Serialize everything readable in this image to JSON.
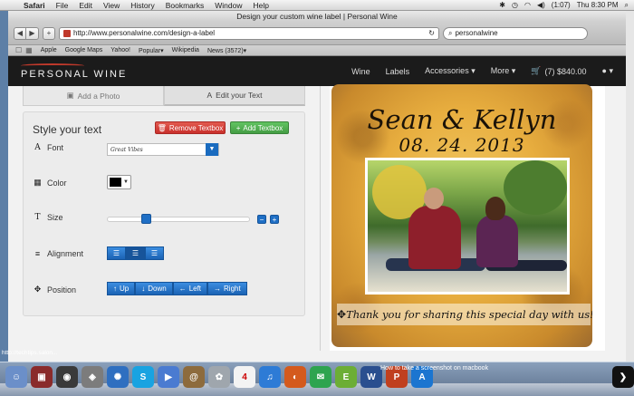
{
  "os_menu": {
    "app": "Safari",
    "items": [
      "File",
      "Edit",
      "View",
      "History",
      "Bookmarks",
      "Window",
      "Help"
    ],
    "battery": "(1:07)",
    "clock": "Thu 8:30 PM"
  },
  "browser": {
    "window_title": "Design your custom wine label | Personal Wine",
    "url": "http://www.personalwine.com/design-a-label",
    "search_value": "personalwine",
    "bookmarks": [
      "Apple",
      "Google Maps",
      "Yahoo!",
      "Popular▾",
      "Wikipedia",
      "News (3572)▾"
    ]
  },
  "site": {
    "logo": "PERSONAL WINE",
    "nav": [
      "Wine",
      "Labels",
      "Accessories ▾",
      "More ▾"
    ],
    "cart": "(7) $840.00",
    "user_menu": "▾"
  },
  "editor": {
    "tabs": [
      "Add a Photo",
      "Edit your Text"
    ],
    "active_tab": 1,
    "heading": "Style your text",
    "remove_label": "Remove Textbox",
    "add_label": "Add Textbox",
    "font_label": "Font",
    "font_value": "Great Vibes",
    "color_label": "Color",
    "color_value": "#000000",
    "size_label": "Size",
    "size_fraction": 0.25,
    "alignment_label": "Alignment",
    "alignment_active": "center",
    "position_label": "Position",
    "position_buttons": [
      "Up",
      "Down",
      "Left",
      "Right"
    ]
  },
  "label": {
    "names": "Sean & Kellyn",
    "date": "08. 24. 2013",
    "thanks": "Thank you for sharing this special day with us!",
    "background": "#e8ae3f"
  },
  "desktop": {
    "left_fragment_1": "http://techtips.salon...",
    "left_fragment_2": "ge-Mac.jpg",
    "dock_tooltip": "How to take a screenshot on macbook",
    "calendar_day": "4"
  }
}
